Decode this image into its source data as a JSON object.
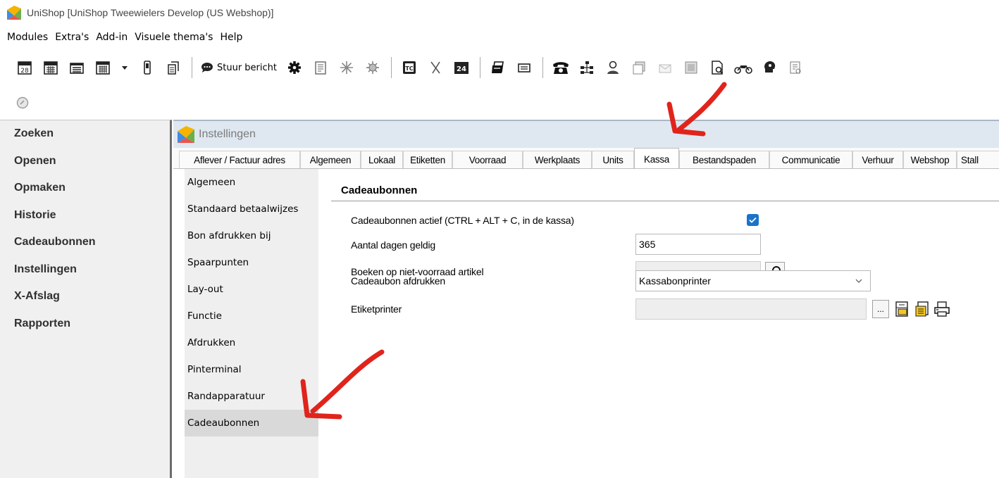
{
  "window": {
    "title": "UniShop [UniShop Tweewielers Develop (US Webshop)]",
    "app_icon": "unishop-logo-icon"
  },
  "menubar": [
    "Modules",
    "Extra's",
    "Add-in",
    "Visuele thema's",
    "Help"
  ],
  "toolbar": {
    "message_button_label": "Stuur bericht",
    "icons": [
      "calendar-day-icon",
      "calendar-week-icon",
      "calendar-month-icon",
      "calendar-grid-icon",
      "dropdown-arrow-icon",
      "phone-device-icon",
      "document-copy-icon",
      "speech-bubble-icon",
      "gear-icon",
      "memo-icon",
      "sparkle-icon",
      "bug-icon",
      "tc-icon",
      "x-tool-icon",
      "24-icon",
      "printer-stack-icon",
      "card-icon",
      "telephone-icon",
      "network-icon",
      "person-icon",
      "window-icon",
      "envelope-icon",
      "grid-icon",
      "page-search-icon",
      "motorbike-icon",
      "head-icon",
      "list-icon",
      "status-circle-icon"
    ]
  },
  "left_nav": {
    "items": [
      "Zoeken",
      "Openen",
      "Opmaken",
      "Historie",
      "Cadeaubonnen",
      "Instellingen",
      "X-Afslag",
      "Rapporten"
    ]
  },
  "settings_window": {
    "title": "Instellingen",
    "tabs": [
      "Aflever / Factuur adres",
      "Algemeen",
      "Lokaal",
      "Etiketten",
      "Voorraad",
      "Werkplaats",
      "Units",
      "Kassa",
      "Bestandspaden",
      "Communicatie",
      "Verhuur",
      "Webshop",
      "Stall"
    ],
    "active_tab": "Kassa",
    "subnav": [
      "Algemeen",
      "Standaard betaalwijzes",
      "Bon afdrukken bij",
      "Spaarpunten",
      "Lay-out",
      "Functie",
      "Afdrukken",
      "Pinterminal",
      "Randapparatuur",
      "Cadeaubonnen"
    ],
    "active_subnav": "Cadeaubonnen"
  },
  "form": {
    "section_title": "Cadeaubonnen",
    "active_label": "Cadeaubonnen actief (CTRL + ALT + C, in de kassa)",
    "active_checked": true,
    "days_label": "Aantal dagen geldig",
    "days_value": "365",
    "article_label": "Boeken op niet-voorraad artikel",
    "article_value": "",
    "print_label": "Cadeaubon afdrukken",
    "print_value": "Kassabonprinter",
    "labelprinter_label": "Etiketprinter",
    "labelprinter_value": "",
    "browse_button_label": "..."
  },
  "colors": {
    "annotation_arrow": "#e0241c",
    "checkbox": "#1a73c9",
    "inner_title_bg": "#dfe8f1"
  }
}
